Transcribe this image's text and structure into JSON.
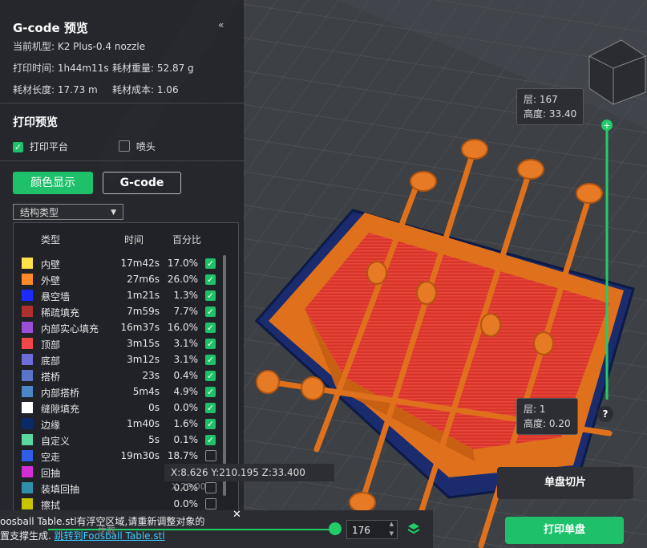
{
  "panel": {
    "title": "G-code 预览",
    "collapse_label": "«",
    "printer_label": "当前机型: K2 Plus-0.4 nozzle",
    "print_time": "打印时间: 1h44m11s",
    "filament_weight": "耗材重量: 52.87 g",
    "filament_length": "耗材长度: 17.73 m",
    "filament_cost": "耗材成本: 1.06",
    "preview_section": "打印预览",
    "print_bed_label": "打印平台",
    "nozzle_label": "喷头",
    "color_display_button": "颜色显示",
    "gcode_button": "G-code",
    "structure_type_select": "结构类型",
    "table": {
      "headers": [
        "类型",
        "时间",
        "百分比"
      ],
      "rows": [
        {
          "name": "内壁",
          "time": "17m42s",
          "pct": "17.0%",
          "color": "#ffe14a",
          "checked": true
        },
        {
          "name": "外壁",
          "time": "27m6s",
          "pct": "26.0%",
          "color": "#ff8a2a",
          "checked": true
        },
        {
          "name": "悬空墙",
          "time": "1m21s",
          "pct": "1.3%",
          "color": "#1d2bff",
          "checked": true
        },
        {
          "name": "稀疏填充",
          "time": "7m59s",
          "pct": "7.7%",
          "color": "#b0302e",
          "checked": true
        },
        {
          "name": "内部实心填充",
          "time": "16m37s",
          "pct": "16.0%",
          "color": "#9b4fd6",
          "checked": true
        },
        {
          "name": "顶部",
          "time": "3m15s",
          "pct": "3.1%",
          "color": "#f04848",
          "checked": true
        },
        {
          "name": "底部",
          "time": "3m12s",
          "pct": "3.1%",
          "color": "#6e6cd8",
          "checked": true
        },
        {
          "name": "搭桥",
          "time": "23s",
          "pct": "0.4%",
          "color": "#5a74c9",
          "checked": true
        },
        {
          "name": "内部搭桥",
          "time": "5m4s",
          "pct": "4.9%",
          "color": "#4a86c8",
          "checked": true
        },
        {
          "name": "缝隙填充",
          "time": "0s",
          "pct": "0.0%",
          "color": "#ffffff",
          "checked": true
        },
        {
          "name": "边缘",
          "time": "1m40s",
          "pct": "1.6%",
          "color": "#0b2a6a",
          "checked": true
        },
        {
          "name": "自定义",
          "time": "5s",
          "pct": "0.1%",
          "color": "#5ad6a0",
          "checked": true
        },
        {
          "name": "空走",
          "time": "19m30s",
          "pct": "18.7%",
          "color": "#2f5fe6",
          "checked": false
        },
        {
          "name": "回抽",
          "time": "",
          "pct": "0.0%",
          "color": "#d62ed6",
          "checked": false
        },
        {
          "name": "装填回抽",
          "time": "",
          "pct": "0.0%",
          "color": "#2f8fa8",
          "checked": false
        },
        {
          "name": "擦拭",
          "time": "",
          "pct": "0.0%",
          "color": "#c8c400",
          "checked": false
        }
      ]
    }
  },
  "layer_top": {
    "layer": "层: 167",
    "height": "高度: 33.40"
  },
  "layer_bottom": {
    "layer": "层: 1",
    "height": "高度: 0.20"
  },
  "help_label": "?",
  "coordinates": "X:8.626 Y:210.195 Z:33.400",
  "coordinates_overlay": "X:20.00",
  "slice_button": "单盘切片",
  "print_button": "打印单盘",
  "notice": {
    "text": "oosball Table.stl有浮空区域,请重新调整对象的",
    "text2": "置支撑生成.",
    "link": "跳转到Foosball Table.stl",
    "close": "✕"
  },
  "bottom": {
    "step_label": "步数",
    "layer_value": "176"
  },
  "colors": {
    "accent": "#1ec06a",
    "slider_line": "#22cc66",
    "model_orange": "#e0711c",
    "model_red": "#d8342c",
    "brim_blue": "#1a2c6e"
  }
}
